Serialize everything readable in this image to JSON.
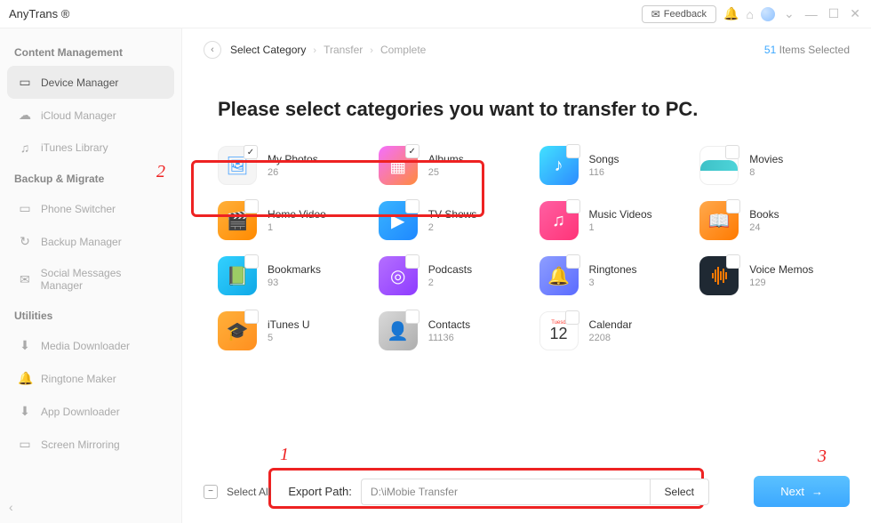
{
  "app": {
    "title": "AnyTrans ®"
  },
  "titlebar": {
    "feedback": "Feedback"
  },
  "sidebar": {
    "sections": [
      {
        "header": "Content Management",
        "items": [
          {
            "icon": "▭",
            "label": "Device Manager",
            "active": true
          },
          {
            "icon": "☁",
            "label": "iCloud Manager"
          },
          {
            "icon": "♫",
            "label": "iTunes Library"
          }
        ]
      },
      {
        "header": "Backup & Migrate",
        "items": [
          {
            "icon": "▭",
            "label": "Phone Switcher"
          },
          {
            "icon": "↻",
            "label": "Backup Manager"
          },
          {
            "icon": "✉",
            "label": "Social Messages Manager"
          }
        ]
      },
      {
        "header": "Utilities",
        "items": [
          {
            "icon": "⬇",
            "label": "Media Downloader"
          },
          {
            "icon": "🔔",
            "label": "Ringtone Maker"
          },
          {
            "icon": "⬇",
            "label": "App Downloader"
          },
          {
            "icon": "▭",
            "label": "Screen Mirroring"
          }
        ]
      }
    ]
  },
  "breadcrumb": {
    "items": [
      "Select Category",
      "Transfer",
      "Complete"
    ],
    "activeIndex": 0,
    "selectedCount": "51",
    "selectedSuffix": " Items Selected"
  },
  "page": {
    "title": "Please select categories you want to transfer to PC."
  },
  "categories": [
    {
      "key": "my-photos",
      "label": "My Photos",
      "count": "26",
      "iconClass": "i-photos",
      "glyph": "🖼",
      "checked": true
    },
    {
      "key": "albums",
      "label": "Albums",
      "count": "25",
      "iconClass": "i-albums",
      "glyph": "▦",
      "checked": true
    },
    {
      "key": "songs",
      "label": "Songs",
      "count": "116",
      "iconClass": "i-songs",
      "glyph": "♪"
    },
    {
      "key": "movies",
      "label": "Movies",
      "count": "8",
      "iconClass": "i-movies",
      "glyph": ""
    },
    {
      "key": "home-video",
      "label": "Home Video",
      "count": "1",
      "iconClass": "i-home",
      "glyph": "🎬"
    },
    {
      "key": "tv-shows",
      "label": "TV Shows",
      "count": "2",
      "iconClass": "i-tv",
      "glyph": "▶"
    },
    {
      "key": "music-videos",
      "label": "Music Videos",
      "count": "1",
      "iconClass": "i-music-v",
      "glyph": "♫"
    },
    {
      "key": "books",
      "label": "Books",
      "count": "24",
      "iconClass": "i-books",
      "glyph": "📖"
    },
    {
      "key": "bookmarks",
      "label": "Bookmarks",
      "count": "93",
      "iconClass": "i-book",
      "glyph": "📗"
    },
    {
      "key": "podcasts",
      "label": "Podcasts",
      "count": "2",
      "iconClass": "i-pod",
      "glyph": "◎"
    },
    {
      "key": "ringtones",
      "label": "Ringtones",
      "count": "3",
      "iconClass": "i-ring",
      "glyph": "🔔"
    },
    {
      "key": "voice-memos",
      "label": "Voice Memos",
      "count": "129",
      "iconClass": "i-voice",
      "glyph": ""
    },
    {
      "key": "itunes-u",
      "label": "iTunes U",
      "count": "5",
      "iconClass": "i-uni",
      "glyph": "🎓"
    },
    {
      "key": "contacts",
      "label": "Contacts",
      "count": "11136",
      "iconClass": "i-cont",
      "glyph": "👤"
    },
    {
      "key": "calendar",
      "label": "Calendar",
      "count": "2208",
      "iconClass": "i-cal",
      "glyph": ""
    }
  ],
  "footer": {
    "selectAllLabel": "Select All",
    "selectAllState": "−",
    "pathLabel": "Export Path:",
    "pathValue": "D:\\iMobie Transfer",
    "selectBtn": "Select",
    "nextBtn": "Next"
  },
  "annotations": {
    "a1": "1",
    "a2": "2",
    "a3": "3"
  },
  "calendar": {
    "day": "Tuesd",
    "num": "12"
  }
}
